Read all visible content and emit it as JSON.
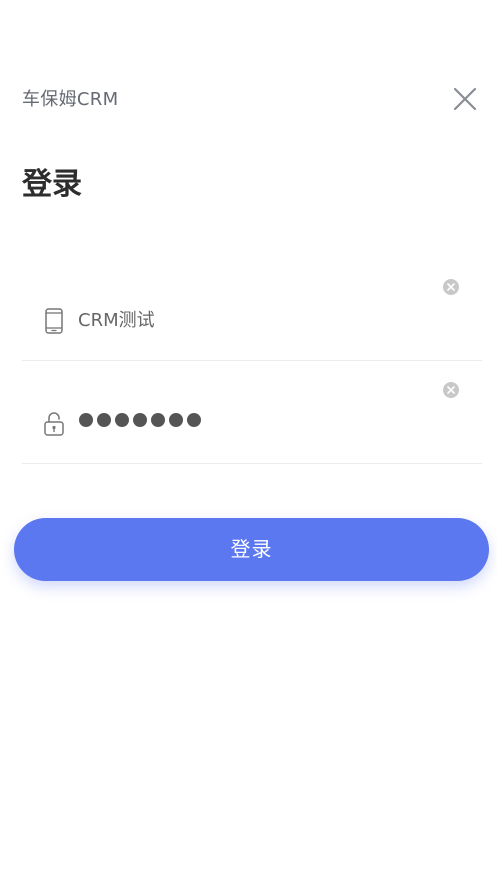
{
  "header": {
    "app_name": "车保姆CRM",
    "close_icon": "close-icon"
  },
  "page": {
    "title": "登录"
  },
  "form": {
    "account": {
      "icon": "mobile-phone-icon",
      "value": "CRM测试",
      "clear_icon": "clear-circle-icon"
    },
    "password": {
      "icon": "unlock-icon",
      "masked_length": 7,
      "clear_icon": "clear-circle-icon"
    },
    "submit_label": "登录"
  },
  "colors": {
    "primary": "#5c78f1",
    "title_text": "#2d2d2d",
    "secondary_text": "#666a73",
    "divider": "#ececec"
  }
}
